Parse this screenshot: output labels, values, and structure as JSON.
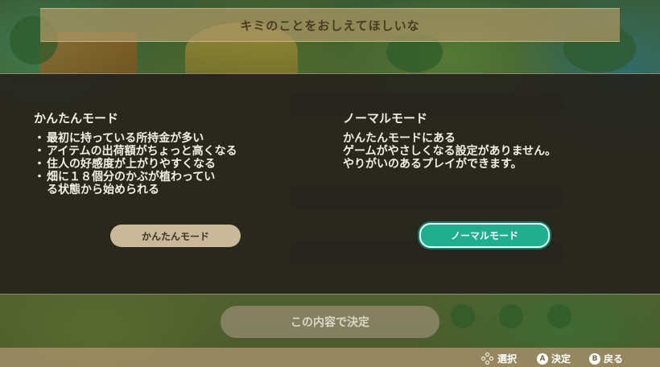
{
  "header": {
    "title": "キミのことをおしえてほしいな"
  },
  "easy_mode": {
    "title": "かんたんモード",
    "bullets": [
      "最初に持っている所持金が多い",
      "アイテムの出荷額がちょっと高くなる",
      "住人の好感度が上がりやすくなる",
      "畑に１８個分のかぶが植わっている状態から始められる"
    ],
    "button_label": "かんたんモード"
  },
  "normal_mode": {
    "title": "ノーマルモード",
    "description_lines": [
      "かんたんモードにある",
      "ゲームがやさしくなる設定がありません。",
      "やりがいのあるプレイができます。"
    ],
    "button_label": "ノーマルモード"
  },
  "confirm_button": {
    "label": "この内容で決定"
  },
  "controls": {
    "select": {
      "icon": "dpad-icon",
      "label": "選択"
    },
    "confirm": {
      "key": "A",
      "label": "決定"
    },
    "back": {
      "key": "B",
      "label": "戻る"
    }
  },
  "colors": {
    "selected_button": "#1fae8e",
    "unselected_button": "#c9b99a",
    "modal_background": "#26241e",
    "title_band": "#aa9664"
  }
}
